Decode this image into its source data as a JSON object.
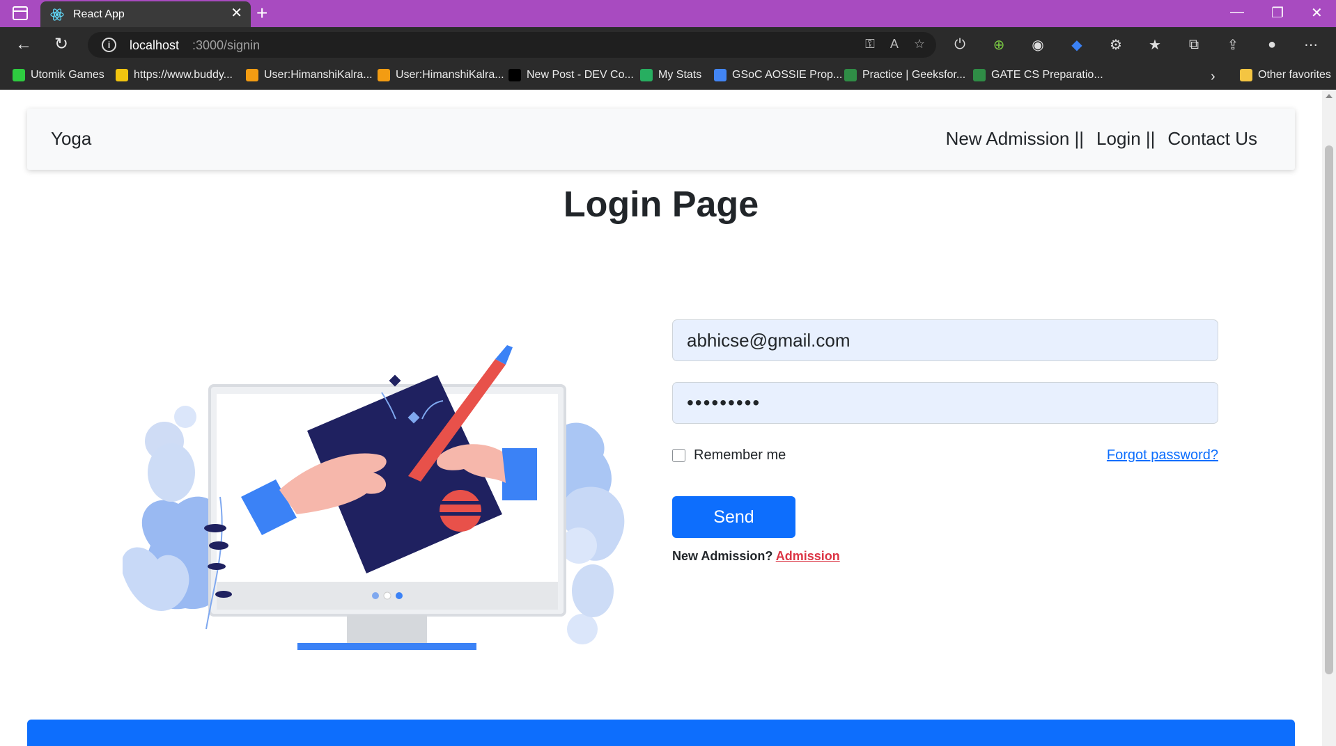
{
  "browser": {
    "tab_title": "React App",
    "url_host": "localhost",
    "url_path": ":3000/signin",
    "favorites": [
      {
        "label": "Utomik Games",
        "color": "#2ecc40"
      },
      {
        "label": "https://www.buddy...",
        "color": "#f1c40f"
      },
      {
        "label": "User:HimanshiKalra...",
        "color": "#f39c12"
      },
      {
        "label": "User:HimanshiKalra...",
        "color": "#f39c12"
      },
      {
        "label": "New Post - DEV Co...",
        "color": "#000000"
      },
      {
        "label": "My Stats",
        "color": "#27ae60"
      },
      {
        "label": "GSoC AOSSIE Prop...",
        "color": "#4285f4"
      },
      {
        "label": "Practice | Geeksfor...",
        "color": "#2f8d46"
      },
      {
        "label": "GATE CS Preparatio...",
        "color": "#2f8d46"
      }
    ],
    "other_favorites": "Other favorites"
  },
  "navbar": {
    "brand": "Yoga",
    "links": [
      "New Admission ||",
      "Login ||",
      "Contact Us"
    ]
  },
  "page": {
    "title": "Login Page"
  },
  "form": {
    "email_value": "abhicse@gmail.com",
    "password_value": "•••••••••",
    "remember_label": "Remember me",
    "forgot_label": "Forgot password?",
    "send_label": "Send",
    "new_admission_text": "New Admission?",
    "admission_link": "Admission"
  },
  "colors": {
    "titlebar": "#a84bc0",
    "primary": "#0d6efd",
    "danger": "#dc3545",
    "input_bg": "#e8f0fe"
  }
}
